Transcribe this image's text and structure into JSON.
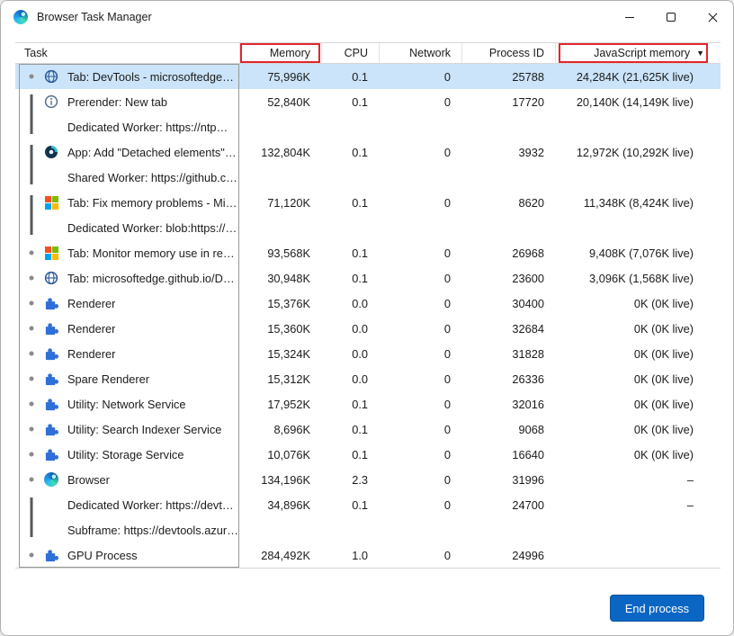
{
  "window": {
    "title": "Browser Task Manager"
  },
  "table": {
    "columns": [
      {
        "key": "task",
        "label": "Task"
      },
      {
        "key": "memory",
        "label": "Memory",
        "annotated": true
      },
      {
        "key": "cpu",
        "label": "CPU"
      },
      {
        "key": "network",
        "label": "Network"
      },
      {
        "key": "pid",
        "label": "Process ID"
      },
      {
        "key": "js",
        "label": "JavaScript memory",
        "annotated": true,
        "sorted": "descending"
      }
    ],
    "sort_indicator": "▼",
    "rows": [
      {
        "indicator": "dot",
        "icon": "globe",
        "label": "Tab: DevTools - microsoftedge…",
        "memory": "75,996K",
        "cpu": "0.1",
        "network": "0",
        "pid": "25788",
        "js": "24,284K (21,625K live)",
        "selected": true
      },
      {
        "indicator": "bar-top",
        "icon": "prerender",
        "label": "Prerender: New tab",
        "memory": "52,840K",
        "cpu": "0.1",
        "network": "0",
        "pid": "17720",
        "js": "20,140K (14,149K live)"
      },
      {
        "indicator": "bar-bottom",
        "icon": null,
        "label": "Dedicated Worker: https://ntp…",
        "memory": "",
        "cpu": "",
        "network": "",
        "pid": "",
        "js": ""
      },
      {
        "indicator": "bar-top",
        "icon": "app",
        "label": "App: Add \"Detached elements\"…",
        "memory": "132,804K",
        "cpu": "0.1",
        "network": "0",
        "pid": "3932",
        "js": "12,972K (10,292K live)"
      },
      {
        "indicator": "bar-bottom",
        "icon": null,
        "label": "Shared Worker: https://github.c…",
        "memory": "",
        "cpu": "",
        "network": "",
        "pid": "",
        "js": ""
      },
      {
        "indicator": "bar-top",
        "icon": "ms-logo",
        "label": "Tab: Fix memory problems - Mi…",
        "memory": "71,120K",
        "cpu": "0.1",
        "network": "0",
        "pid": "8620",
        "js": "11,348K (8,424K live)"
      },
      {
        "indicator": "bar-bottom",
        "icon": null,
        "label": "Dedicated Worker: blob:https://…",
        "memory": "",
        "cpu": "",
        "network": "",
        "pid": "",
        "js": ""
      },
      {
        "indicator": "dot",
        "icon": "ms-logo",
        "label": "Tab: Monitor memory use in re…",
        "memory": "93,568K",
        "cpu": "0.1",
        "network": "0",
        "pid": "26968",
        "js": "9,408K (7,076K live)"
      },
      {
        "indicator": "dot",
        "icon": "globe",
        "label": "Tab: microsoftedge.github.io/D…",
        "memory": "30,948K",
        "cpu": "0.1",
        "network": "0",
        "pid": "23600",
        "js": "3,096K (1,568K live)"
      },
      {
        "indicator": "dot",
        "icon": "puzzle",
        "label": "Renderer",
        "memory": "15,376K",
        "cpu": "0.0",
        "network": "0",
        "pid": "30400",
        "js": "0K (0K live)"
      },
      {
        "indicator": "dot",
        "icon": "puzzle",
        "label": "Renderer",
        "memory": "15,360K",
        "cpu": "0.0",
        "network": "0",
        "pid": "32684",
        "js": "0K (0K live)"
      },
      {
        "indicator": "dot",
        "icon": "puzzle",
        "label": "Renderer",
        "memory": "15,324K",
        "cpu": "0.0",
        "network": "0",
        "pid": "31828",
        "js": "0K (0K live)"
      },
      {
        "indicator": "dot",
        "icon": "puzzle",
        "label": "Spare Renderer",
        "memory": "15,312K",
        "cpu": "0.0",
        "network": "0",
        "pid": "26336",
        "js": "0K (0K live)"
      },
      {
        "indicator": "dot",
        "icon": "puzzle",
        "label": "Utility: Network Service",
        "memory": "17,952K",
        "cpu": "0.1",
        "network": "0",
        "pid": "32016",
        "js": "0K (0K live)"
      },
      {
        "indicator": "dot",
        "icon": "puzzle",
        "label": "Utility: Search Indexer Service",
        "memory": "8,696K",
        "cpu": "0.1",
        "network": "0",
        "pid": "9068",
        "js": "0K (0K live)"
      },
      {
        "indicator": "dot",
        "icon": "puzzle",
        "label": "Utility: Storage Service",
        "memory": "10,076K",
        "cpu": "0.1",
        "network": "0",
        "pid": "16640",
        "js": "0K (0K live)"
      },
      {
        "indicator": "dot",
        "icon": "edge",
        "label": "Browser",
        "memory": "134,196K",
        "cpu": "2.3",
        "network": "0",
        "pid": "31996",
        "js": "–"
      },
      {
        "indicator": "bar-top",
        "icon": null,
        "label": "Dedicated Worker: https://devt…",
        "memory": "34,896K",
        "cpu": "0.1",
        "network": "0",
        "pid": "24700",
        "js": "–"
      },
      {
        "indicator": "bar-bottom",
        "icon": null,
        "label": "Subframe: https://devtools.azur…",
        "memory": "",
        "cpu": "",
        "network": "",
        "pid": "",
        "js": ""
      },
      {
        "indicator": "dot",
        "icon": "puzzle",
        "label": "GPU Process",
        "memory": "284,492K",
        "cpu": "1.0",
        "network": "0",
        "pid": "24996",
        "js": ""
      }
    ]
  },
  "footer": {
    "end_process_label": "End process"
  },
  "colors": {
    "accent": "#0b66c3",
    "selection": "#cbe4f9",
    "annotation_red": "#e1262d",
    "ms_red": "#f25022",
    "ms_green": "#7fba00",
    "ms_blue": "#00a4ef",
    "ms_yellow": "#ffb900",
    "puzzle_blue": "#2f6fd8"
  }
}
